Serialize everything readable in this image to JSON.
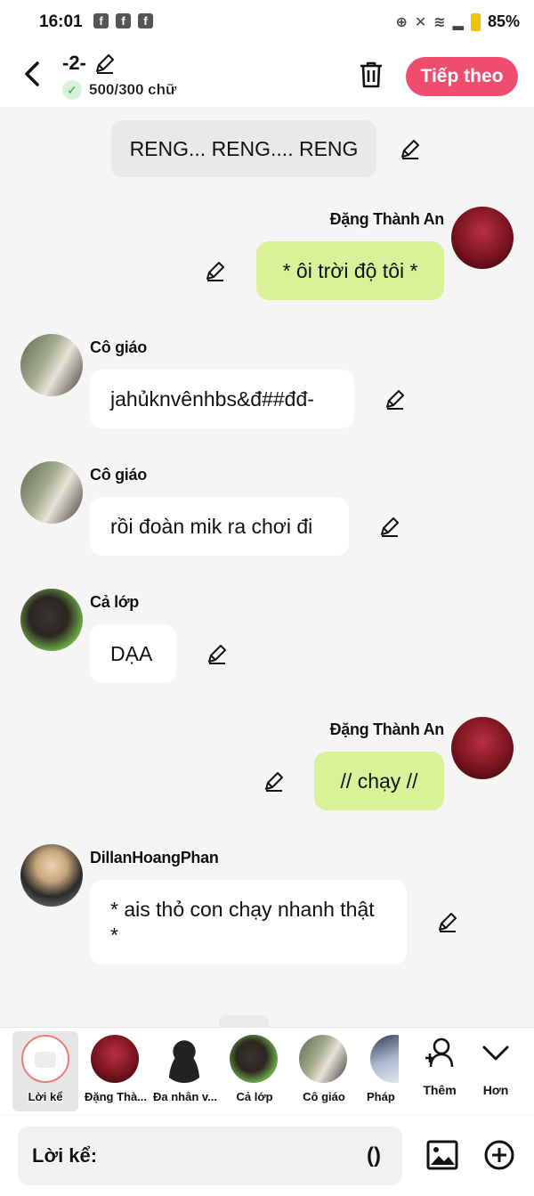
{
  "status": {
    "time": "16:01",
    "battery": "85%"
  },
  "header": {
    "back": "‹",
    "title": "-2-",
    "word_count": "500/300 chữ",
    "next_button": "Tiếp theo"
  },
  "messages": {
    "narration": "RENG... RENG.... RENG",
    "m1": {
      "name": "Đặng Thành An",
      "text": "* ôi trời độ tôi *"
    },
    "m2": {
      "name": "Cô giáo",
      "text": "jahủknvênhbs&đ##đđ-"
    },
    "m3": {
      "name": "Cô giáo",
      "text": "rồi đoàn mik ra chơi đi"
    },
    "m4": {
      "name": "Cả lớp",
      "text": "DẠA"
    },
    "m5": {
      "name": "Đặng Thành An",
      "text": "// chạy //"
    },
    "m6": {
      "name": "DillanHoangPhan",
      "text": "* ais thỏ con chạy nhanh thật *"
    }
  },
  "characters": [
    {
      "label": "Lời kể"
    },
    {
      "label": "Đặng Thà..."
    },
    {
      "label": "Đa nhân v..."
    },
    {
      "label": "Cả lớp"
    },
    {
      "label": "Cô giáo"
    },
    {
      "label": "Pháp"
    }
  ],
  "side_buttons": {
    "add_label": "Thêm",
    "more_label": "Hơn"
  },
  "input": {
    "label": "Lời kể:",
    "paren": "()"
  },
  "colors": {
    "accent": "#ee4d6d",
    "user_bubble": "#d9f297",
    "other_bubble": "#ffffff"
  }
}
